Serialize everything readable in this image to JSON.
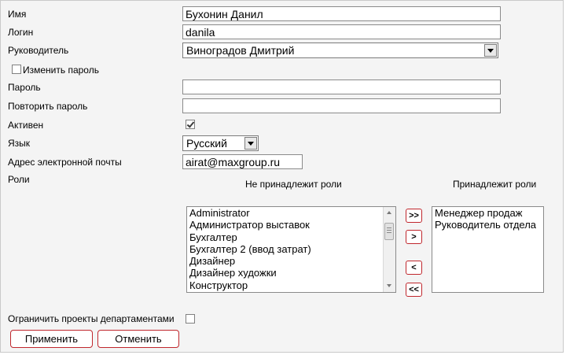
{
  "form": {
    "name": {
      "label": "Имя",
      "value": "Бухонин Данил"
    },
    "login": {
      "label": "Логин",
      "value": "danila"
    },
    "manager": {
      "label": "Руководитель",
      "value": "Виноградов Дмитрий"
    },
    "change_password": {
      "label": "Изменить пароль",
      "checked": false
    },
    "password": {
      "label": "Пароль",
      "value": ""
    },
    "repeat_password": {
      "label": "Повторить пароль",
      "value": ""
    },
    "active": {
      "label": "Активен",
      "checked": true
    },
    "language": {
      "label": "Язык",
      "value": "Русский"
    },
    "email": {
      "label": "Адрес электронной почты",
      "value": "airat@maxgroup.ru"
    },
    "roles": {
      "label": "Роли",
      "not_assigned_header": "Не принадлежит роли",
      "assigned_header": "Принадлежит роли",
      "not_assigned": [
        "Administrator",
        "Администратор выставок",
        "Бухгалтер",
        "Бухгалтер 2 (ввод затрат)",
        "Дизайнер",
        "Дизайнер художки",
        "Конструктор"
      ],
      "assigned": [
        "Менеджер продаж",
        "Руководитель отдела"
      ],
      "move_all_right": ">>",
      "move_right": ">",
      "move_left": "<",
      "move_all_left": "<<"
    },
    "restrict_departments": {
      "label": "Ограничить проекты департаментами",
      "checked": false
    },
    "apply_button": "Применить",
    "cancel_button": "Отменить"
  },
  "colors": {
    "button_border": "#c0272d",
    "frame_background": "#f4f4f4"
  }
}
